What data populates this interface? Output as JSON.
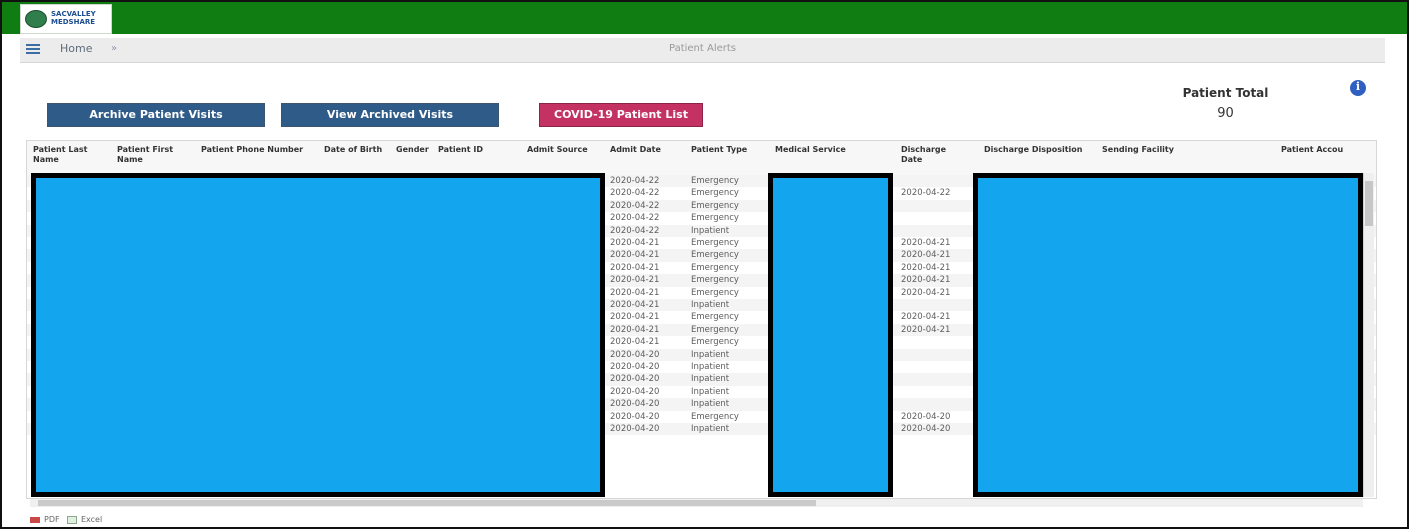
{
  "brand": {
    "line1": "SACVALLEY",
    "line2": "MEDSHARE"
  },
  "nav": {
    "home": "Home",
    "title": "Patient Alerts"
  },
  "actions": {
    "archive": "Archive Patient Visits",
    "view_archived": "View Archived Visits",
    "covid_list": "COVID-19 Patient List"
  },
  "summary": {
    "label": "Patient Total",
    "value": "90"
  },
  "table": {
    "columns": [
      "Patient Last\nName",
      "Patient First\nName",
      "Patient Phone Number",
      "Date of Birth",
      "Gender",
      "Patient ID",
      "Admit Source",
      "Admit Date",
      "Patient Type",
      "Medical Service",
      "Discharge\nDate",
      "Discharge Disposition",
      "Sending Facility",
      "Patient Accou"
    ],
    "rows": [
      {
        "admit_date": "2020-04-22",
        "patient_type": "Emergency",
        "discharge_date": ""
      },
      {
        "admit_date": "2020-04-22",
        "patient_type": "Emergency",
        "discharge_date": "2020-04-22"
      },
      {
        "admit_date": "2020-04-22",
        "patient_type": "Emergency",
        "discharge_date": ""
      },
      {
        "admit_date": "2020-04-22",
        "patient_type": "Emergency",
        "discharge_date": ""
      },
      {
        "admit_date": "2020-04-22",
        "patient_type": "Inpatient",
        "discharge_date": ""
      },
      {
        "admit_date": "2020-04-21",
        "patient_type": "Emergency",
        "discharge_date": "2020-04-21"
      },
      {
        "admit_date": "2020-04-21",
        "patient_type": "Emergency",
        "discharge_date": "2020-04-21"
      },
      {
        "admit_date": "2020-04-21",
        "patient_type": "Emergency",
        "discharge_date": "2020-04-21"
      },
      {
        "admit_date": "2020-04-21",
        "patient_type": "Emergency",
        "discharge_date": "2020-04-21"
      },
      {
        "admit_date": "2020-04-21",
        "patient_type": "Emergency",
        "discharge_date": "2020-04-21"
      },
      {
        "admit_date": "2020-04-21",
        "patient_type": "Inpatient",
        "discharge_date": ""
      },
      {
        "admit_date": "2020-04-21",
        "patient_type": "Emergency",
        "discharge_date": "2020-04-21"
      },
      {
        "admit_date": "2020-04-21",
        "patient_type": "Emergency",
        "discharge_date": "2020-04-21"
      },
      {
        "admit_date": "2020-04-21",
        "patient_type": "Emergency",
        "discharge_date": ""
      },
      {
        "admit_date": "2020-04-20",
        "patient_type": "Inpatient",
        "discharge_date": ""
      },
      {
        "admit_date": "2020-04-20",
        "patient_type": "Inpatient",
        "discharge_date": ""
      },
      {
        "admit_date": "2020-04-20",
        "patient_type": "Inpatient",
        "discharge_date": ""
      },
      {
        "admit_date": "2020-04-20",
        "patient_type": "Inpatient",
        "discharge_date": ""
      },
      {
        "admit_date": "2020-04-20",
        "patient_type": "Inpatient",
        "discharge_date": ""
      },
      {
        "admit_date": "2020-04-20",
        "patient_type": "Emergency",
        "discharge_date": "2020-04-20"
      },
      {
        "admit_date": "2020-04-20",
        "patient_type": "Inpatient",
        "discharge_date": "2020-04-20"
      }
    ]
  },
  "export": {
    "pdf": "PDF",
    "excel": "Excel"
  },
  "colors": {
    "brand_green": "#0f7d12",
    "primary_blue": "#2f5b88",
    "covid_pink": "#c33262",
    "redaction_blue": "#13a6ef"
  }
}
